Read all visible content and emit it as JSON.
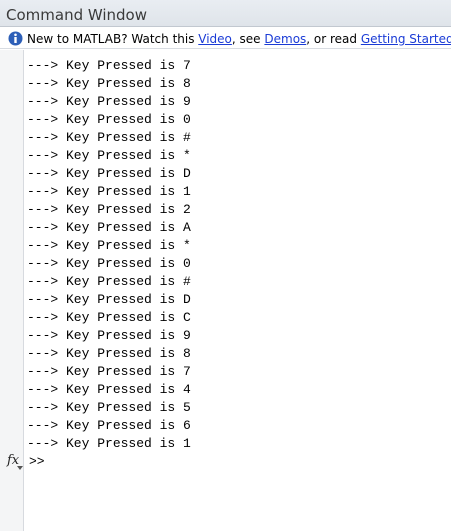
{
  "window": {
    "title": "Command Window"
  },
  "infobar": {
    "icon": "info-icon",
    "text_before": "New to MATLAB? Watch this ",
    "link_video": "Video",
    "text_mid1": ", see ",
    "link_demos": "Demos",
    "text_mid2": ", or read ",
    "link_getting_started": "Getting Started",
    "text_end": "."
  },
  "output": {
    "lines": [
      "---> Key Pressed is 7",
      "---> Key Pressed is 8",
      "---> Key Pressed is 9",
      "---> Key Pressed is 0",
      "---> Key Pressed is #",
      "---> Key Pressed is *",
      "---> Key Pressed is D",
      "---> Key Pressed is 1",
      "---> Key Pressed is 2",
      "---> Key Pressed is A",
      "---> Key Pressed is *",
      "---> Key Pressed is 0",
      "---> Key Pressed is #",
      "---> Key Pressed is D",
      "---> Key Pressed is C",
      "---> Key Pressed is 9",
      "---> Key Pressed is 8",
      "---> Key Pressed is 7",
      "---> Key Pressed is 4",
      "---> Key Pressed is 5",
      "---> Key Pressed is 6",
      "---> Key Pressed is 1"
    ]
  },
  "prompt": {
    "fx_label": "fx",
    "text": ">>"
  },
  "colors": {
    "link": "#1a3bd6",
    "titlebar": "#e3e8ee"
  }
}
